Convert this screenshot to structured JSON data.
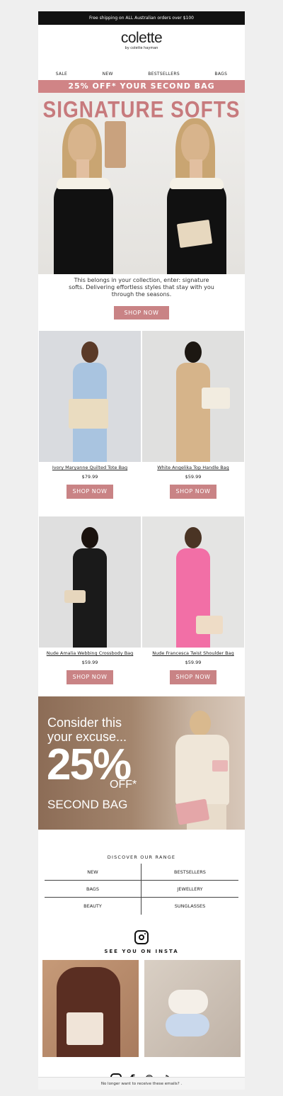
{
  "topbar": {
    "text": "Free shipping on ALL Australian orders over $100"
  },
  "logo": {
    "name": "colette",
    "sub": "by colette hayman"
  },
  "nav": [
    "SALE",
    "NEW",
    "BESTSELLERS",
    "BAGS"
  ],
  "promo": {
    "text": "25% OFF* YOUR SECOND BAG"
  },
  "hero": {
    "title": "SIGNATURE SOFTS",
    "intro": "This belongs in your collection, enter: signature softs. Delivering effortless styles that stay with you through the seasons.",
    "cta": "SHOP NOW"
  },
  "products": [
    {
      "name": "Ivory Maryanne Quilted Tote Bag",
      "price": "$79.99",
      "cta": "SHOP NOW",
      "bg": "#d9dbdf",
      "outfit": "#a9c4e0",
      "hair": "#5a3a28",
      "bag": "#eadcc0"
    },
    {
      "name": "White Angelika Top Handle Bag",
      "price": "$59.99",
      "cta": "SHOP NOW",
      "bg": "#e0e0df",
      "outfit": "#d6b48a",
      "hair": "#1c1712",
      "bag": "#f2ece0"
    },
    {
      "name": "Nude Amalia Webbing Crossbody Bag",
      "price": "$59.99",
      "cta": "SHOP NOW",
      "bg": "#dfdfdf",
      "outfit": "#1a1a1a",
      "hair": "#1a120e",
      "bag": "#e6d6bd"
    },
    {
      "name": "Nude Francesca Twist Shoulder Bag",
      "price": "$59.99",
      "cta": "SHOP NOW",
      "bg": "#e4e4e3",
      "outfit": "#f26fa6",
      "hair": "#4a3424",
      "bag": "#eedcc6"
    }
  ],
  "banner": {
    "line1": "Consider this",
    "line2": "your excuse...",
    "pct": "25%",
    "off": "OFF*",
    "second": "SECOND BAG"
  },
  "range": {
    "title": "DISCOVER OUR RANGE",
    "items": [
      "NEW",
      "BESTSELLERS",
      "BAGS",
      "JEWELLERY",
      "BEAUTY",
      "SUNGLASSES"
    ]
  },
  "insta": {
    "title": "SEE YOU ON INSTA"
  },
  "socials": [
    "instagram-icon",
    "facebook-icon",
    "pinterest-icon",
    "tiktok-icon"
  ],
  "footer": {
    "text": "No longer want to receive these emails? ."
  },
  "colors": {
    "accent": "#c98385",
    "promo_bar": "#d08486",
    "hero_title": "#c77a7d"
  }
}
